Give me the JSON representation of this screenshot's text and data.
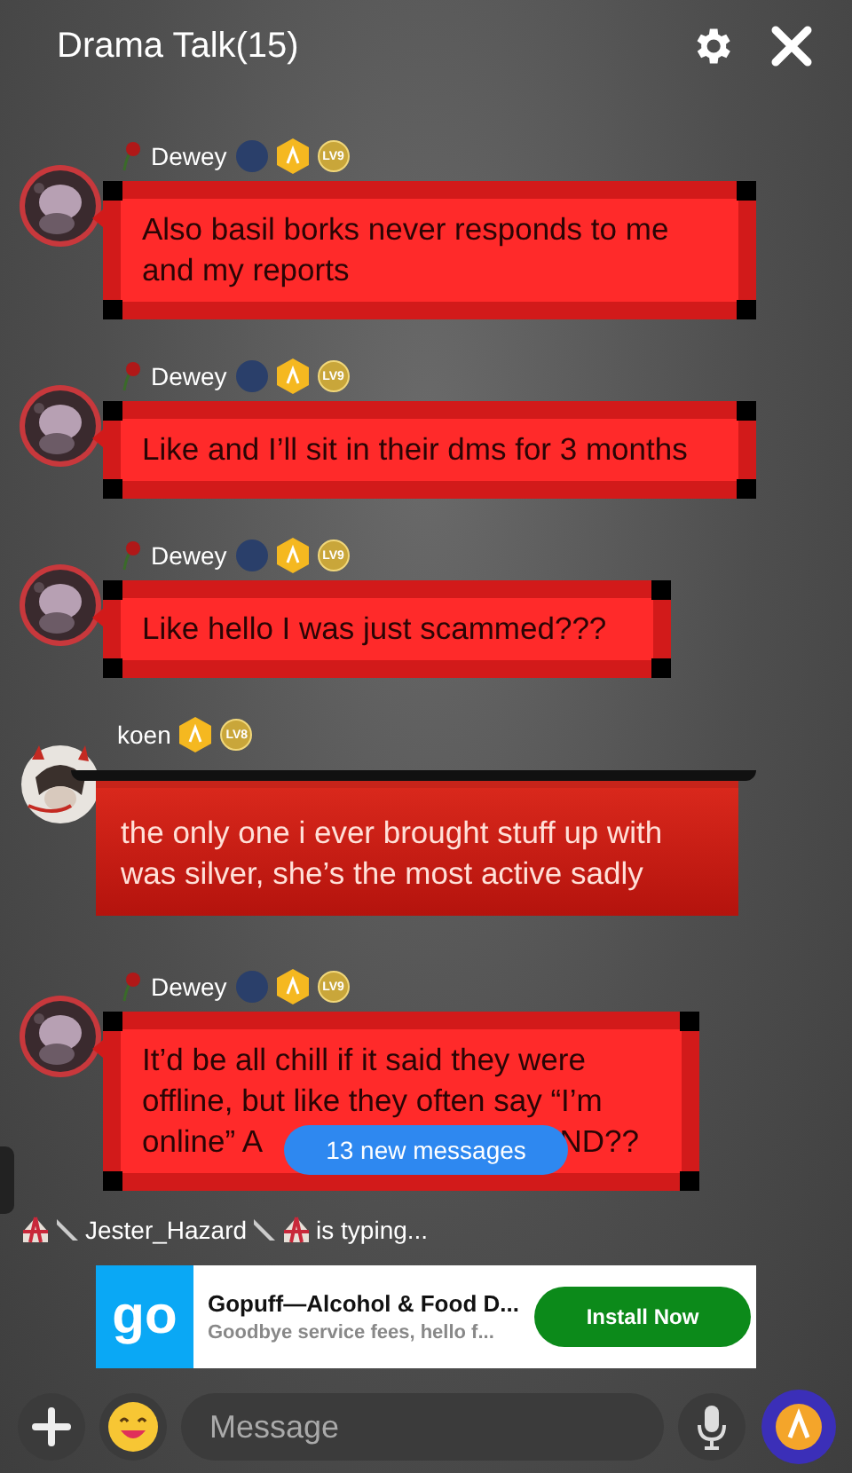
{
  "header": {
    "title": "Drama Talk(15)"
  },
  "messages": [
    {
      "author": "Dewey",
      "kind": "frame",
      "level_badge": "LV9",
      "text": "Also basil borks never responds to me and my reports"
    },
    {
      "author": "Dewey",
      "kind": "frame",
      "level_badge": "LV9",
      "text": "Like and I’ll sit in their dms for 3 months"
    },
    {
      "author": "Dewey",
      "kind": "frame",
      "level_badge": "LV9",
      "text": "Like hello I was just scammed???"
    },
    {
      "author": "koen",
      "kind": "banner",
      "level_badge": "LV8",
      "text": "the only one i ever brought stuff up with was silver, she’s the most active sadly"
    },
    {
      "author": "Dewey",
      "kind": "frame",
      "level_badge": "LV9",
      "text": "It’d be all chill if it said they were offline, but like they often say “I’m",
      "cut_line": "online” A",
      "text_after_hidden": "ND??"
    }
  ],
  "new_messages": "13 new messages",
  "typing": {
    "user": "Jester_Hazard",
    "status": "is typing..."
  },
  "ad": {
    "logo": "go",
    "title": "Gopuff—Alcohol & Food D...",
    "subtitle": "Goodbye service fees, hello f...",
    "button": "Install Now"
  },
  "composer": {
    "placeholder": "Message"
  }
}
